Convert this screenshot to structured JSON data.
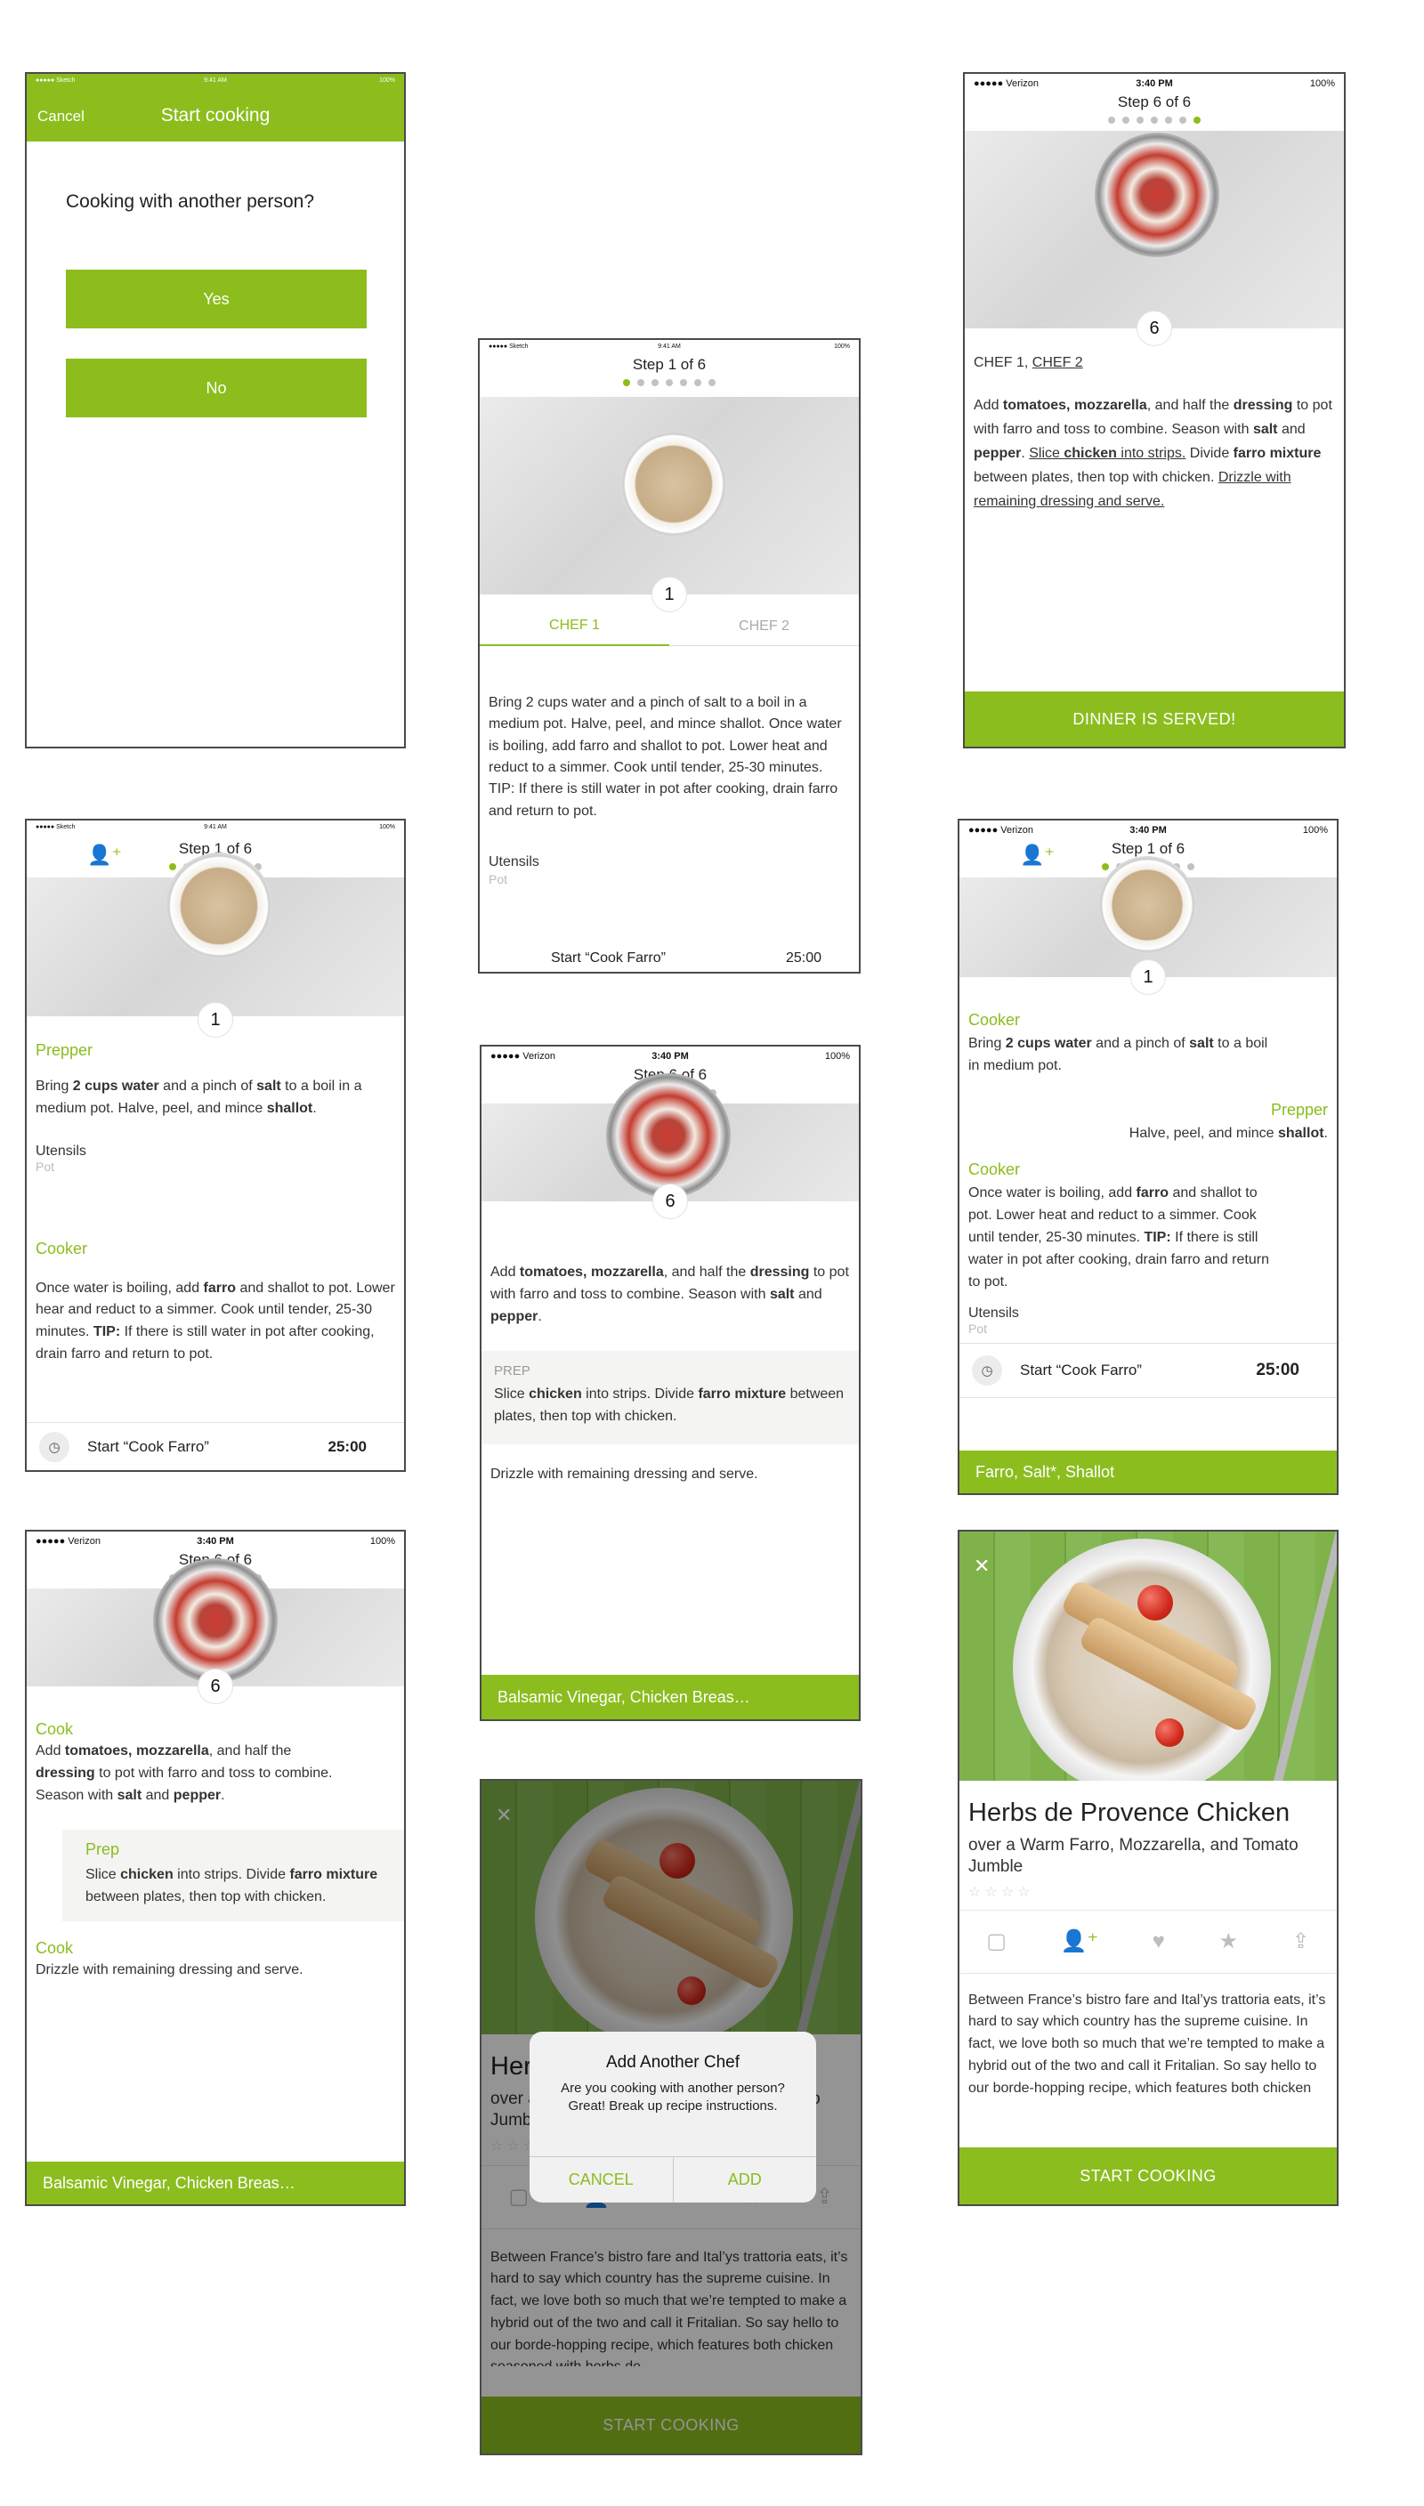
{
  "status": {
    "carrier": "Verizon",
    "sketch_carrier": "Sketch",
    "time": "3:40 PM",
    "sketch_time": "9:41 AM",
    "battery": "100%"
  },
  "screen1": {
    "cancel": "Cancel",
    "title": "Start cooking",
    "question": "Cooking with another person?",
    "yes": "Yes",
    "no": "No"
  },
  "step1_tabs": {
    "step_title": "Step 1 of 6",
    "step_num": "1",
    "tab1": "CHEF 1",
    "tab2": "CHEF 2",
    "instructions": "Bring 2 cups water and a pinch of salt to a boil in a medium pot. Halve, peel, and mince shallot. Once water is boiling, add farro and shallot to pot. Lower heat and reduct to a simmer. Cook until tender, 25-30 minutes. TIP: If there is still water in pot after cooking, drain farro and return to pot.",
    "utensils_label": "Utensils",
    "utensils_value": "Pot",
    "timer_label": "Start “Cook Farro”",
    "timer_value": "25:00"
  },
  "step6_final": {
    "step_title": "Step 6 of 6",
    "step_num": "6",
    "chef1": "CHEF 1,",
    "chef2": "CHEF 2",
    "p_add": "Add ",
    "p_tom": "tomatoes, mozzarella",
    "p_half": ", and half the ",
    "p_dressing": "dressing",
    "p_pot": " to pot with farro and toss to combine. Season with ",
    "p_salt": "salt",
    "p_and": " and ",
    "p_pepper": "pepper",
    "p_dot": ". ",
    "p_slice": "Slice ",
    "p_chicken": "chicken",
    "p_strips": " into strips.",
    "p_divide": " Divide ",
    "p_farro": "farro mixture",
    "p_between": " between plates, then top with chicken. ",
    "p_drizzle": "Drizzle with remaining dressing and serve.",
    "cta": "DINNER IS SERVED!"
  },
  "step1_roles": {
    "step_title": "Step 1 of 6",
    "step_num": "1",
    "prepper": "Prepper",
    "prep_a": "Bring ",
    "prep_b": "2 cups water",
    "prep_c": " and a pinch of ",
    "prep_d": "salt",
    "prep_e": " to a boil in a medium pot. Halve, peel, and mince ",
    "prep_f": "shallot",
    "prep_g": ".",
    "utensils_label": "Utensils",
    "utensils_value": "Pot",
    "cooker": "Cooker",
    "cook_a": "Once water is boiling, add ",
    "cook_b": "farro",
    "cook_c": " and shallot to pot. Lower hear and reduct to a simmer. Cook until tender, 25-30 minutes. ",
    "cook_d": "TIP:",
    "cook_e": " If there is still water in pot after cooking, drain farro and return to pot.",
    "timer_label": "Start “Cook Farro”",
    "timer_value": "25:00"
  },
  "step6_prep": {
    "step_title": "Step 6 of 6",
    "step_num": "6",
    "a1": "Add ",
    "a2": "tomatoes, mozzarella",
    "a3": ", and half the ",
    "a4": "dressing",
    "a5": " to pot with farro and toss to combine. Season with ",
    "a6": "salt",
    "a7": " and ",
    "a8": "pepper",
    "a9": ".",
    "prep_label": "PREP",
    "b1": "Slice ",
    "b2": "chicken",
    "b3": " into strips. Divide ",
    "b4": "farro mixture",
    "b5": " between plates, then top with chicken.",
    "drizzle": "Drizzle with remaining dressing and serve.",
    "bar": "Balsamic Vinegar, Chicken Breas…"
  },
  "step1_chat": {
    "step_title": "Step 1 of 6",
    "step_num": "1",
    "cooker": "Cooker",
    "c1": "Bring ",
    "c2": "2 cups water",
    "c3": " and a pinch of ",
    "c4": "salt",
    "c5": " to a boil in medium pot.",
    "prepper": "Prepper",
    "p1": "Halve, peel, and mince ",
    "p2": "shallot",
    "p3": ".",
    "cooker2": "Cooker",
    "d1": "Once water is boiling, add ",
    "d2": "farro",
    "d3": " and shallot to pot. Lower heat and reduct to a simmer. Cook until tender, 25-30 minutes. ",
    "d4": "TIP:",
    "d5": " If there is still water in pot after cooking, drain farro and return to pot.",
    "utensils_label": "Utensils",
    "utensils_value": "Pot",
    "timer_label": "Start “Cook Farro”",
    "timer_value": "25:00",
    "bar": "Farro, Salt*, Shallot"
  },
  "step6_cook": {
    "step_title": "Step 6 of 6",
    "step_num": "6",
    "cook": "Cook",
    "a1": "Add ",
    "a2": "tomatoes, mozzarella",
    "a3": ", and half the ",
    "a4": "dressing",
    "a5": " to pot with farro and toss to combine. Season with ",
    "a6": "salt",
    "a7": " and ",
    "a8": "pepper",
    "a9": ".",
    "prep": "Prep",
    "b1": "Slice ",
    "b2": "chicken",
    "b3": " into strips. Divide ",
    "b4": "farro mixture",
    "b5": " between plates, then top with chicken.",
    "cook2": "Cook",
    "drizzle": "Drizzle with remaining dressing and serve.",
    "bar": "Balsamic Vinegar, Chicken Breas…"
  },
  "recipe": {
    "title": "Herbs de Provence Chicken",
    "subtitle": "over a Warm Farro, Mozzarella, and Tomato Jumble",
    "stars": "☆☆☆☆",
    "description": "Between France’s bistro fare and Ital’ys trattoria eats, it’s hard to say which country has the supreme cuisine. In fact, we love both so much that we’re tempted to make a hybrid out of the two and call it Fritalian. So say hello to our borde-hopping recipe, which features both chicken seasoned with herbs de",
    "cta": "START COOKING",
    "dialog_title": "Add Another Chef",
    "dialog_message": "Are you cooking with another person? Great! Break up recipe instructions.",
    "dialog_cancel": "CANCEL",
    "dialog_add": "ADD",
    "close_glyph": "✕"
  },
  "icons": [
    "calendar-icon",
    "add-user-icon",
    "heart-icon",
    "star-icon",
    "share-icon",
    "timer-icon",
    "close-icon"
  ],
  "colors": {
    "accent": "#8bbd1d",
    "frame": "#4a4a4a"
  }
}
